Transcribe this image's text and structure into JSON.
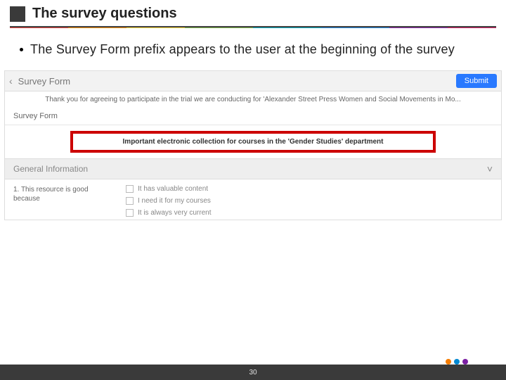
{
  "title": "The survey questions",
  "bullet": "The Survey Form prefix appears to the user at the beginning of the survey",
  "shot": {
    "header_title": "Survey Form",
    "submit": "Submit",
    "intro": "Thank you for agreeing to participate in the trial we are conducting for 'Alexander Street Press Women and Social Movements in Mo...",
    "section_mini": "Survey Form",
    "highlight": "Important electronic collection for courses in the 'Gender Studies' department",
    "accordion": "General Information",
    "question_label": "1. This resource is good because",
    "options": [
      "It has valuable content",
      "I need it for my courses",
      "It is always very current"
    ]
  },
  "page_number": "30"
}
